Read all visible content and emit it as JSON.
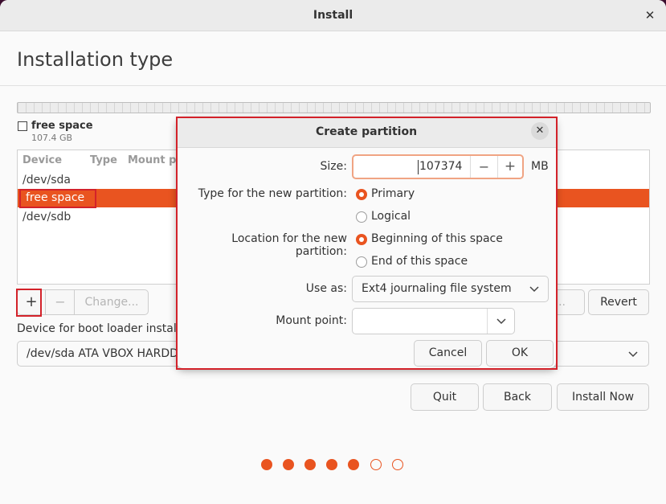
{
  "window": {
    "title": "Install",
    "close_glyph": "✕"
  },
  "page": {
    "title": "Installation type"
  },
  "disk": {
    "legend_label": "free space",
    "legend_size": "107.4 GB",
    "columns": [
      "Device",
      "Type",
      "Mount p"
    ],
    "rows": [
      {
        "device": "/dev/sda",
        "selected": false
      },
      {
        "device": "free space",
        "selected": true
      },
      {
        "device": "/dev/sdb",
        "selected": false
      }
    ]
  },
  "partition_buttons": {
    "add": "+",
    "remove": "−",
    "change": "Change...",
    "new_table_partial": "e...",
    "revert": "Revert"
  },
  "bootloader": {
    "label": "Device for boot loader installa",
    "value": "/dev/sda  ATA VBOX HARDD"
  },
  "nav": {
    "quit": "Quit",
    "back": "Back",
    "install_now": "Install Now"
  },
  "progress": {
    "total_steps": 7,
    "completed_steps": 5,
    "accent": "#e95420"
  },
  "dialog": {
    "title": "Create partition",
    "close_glyph": "✕",
    "size_label": "Size:",
    "size_value": "107374",
    "size_unit": "MB",
    "decrement": "−",
    "increment": "+",
    "type_label": "Type for the new partition:",
    "type_options": [
      {
        "label": "Primary",
        "selected": true
      },
      {
        "label": "Logical",
        "selected": false
      }
    ],
    "location_label": "Location for the new partition:",
    "location_options": [
      {
        "label": "Beginning of this space",
        "selected": true
      },
      {
        "label": "End of this space",
        "selected": false
      }
    ],
    "use_as_label": "Use as:",
    "use_as_value": "Ext4 journaling file system",
    "mount_label": "Mount point:",
    "mount_value": "",
    "cancel": "Cancel",
    "ok": "OK"
  },
  "colors": {
    "accent": "#e95420",
    "highlight": "#d3222a"
  }
}
